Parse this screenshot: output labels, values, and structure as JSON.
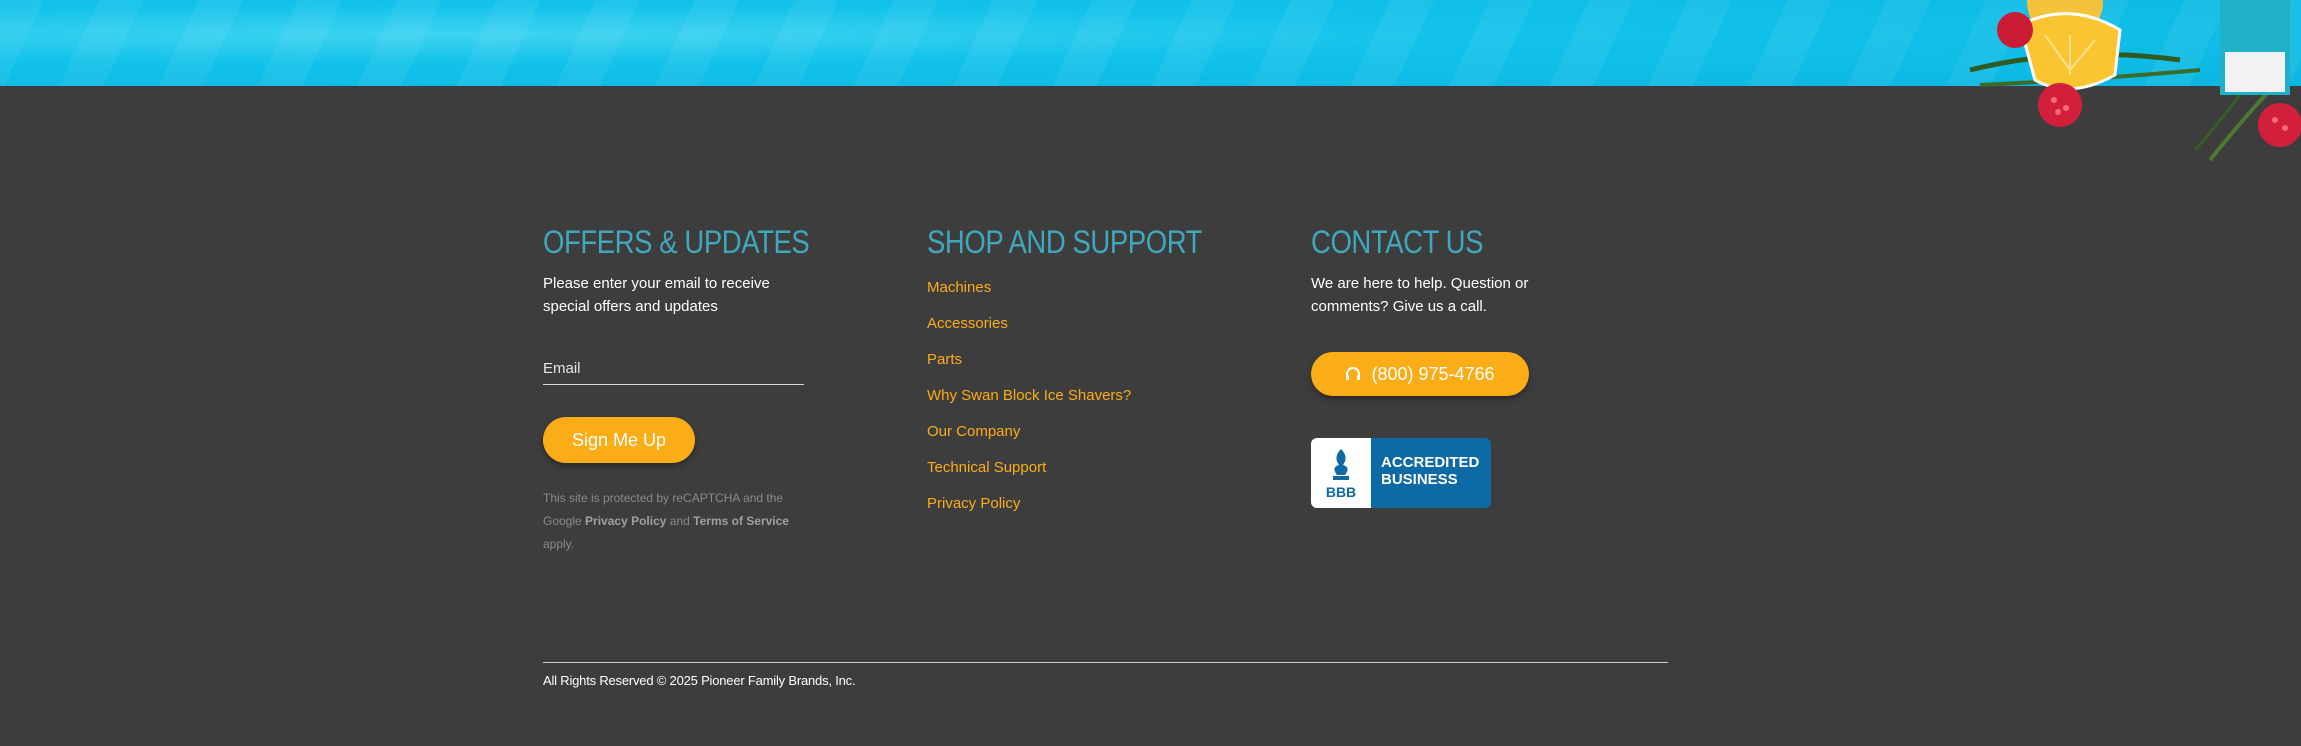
{
  "offers": {
    "title": "OFFERS & UPDATES",
    "description": "Please enter your email to receive special offers and updates",
    "email_placeholder": "Email",
    "signup_label": "Sign Me Up",
    "recaptcha_prefix": "This site is protected by reCAPTCHA and the Google",
    "privacy_link": "Privacy Policy",
    "and_text": "and",
    "terms_link": "Terms of Service",
    "apply_text": "apply."
  },
  "shop": {
    "title": "SHOP AND SUPPORT",
    "links": [
      "Machines",
      "Accessories",
      "Parts",
      "Why Swan Block Ice Shavers?",
      "Our Company",
      "Technical Support",
      "Privacy Policy"
    ]
  },
  "contact": {
    "title": "CONTACT US",
    "description": "We are here to help. Question or comments? Give us a call.",
    "phone": "(800) 975-4766",
    "bbb_mark": "BBB",
    "bbb_line1": "ACCREDITED",
    "bbb_line2": "BUSINESS"
  },
  "footer": {
    "copyright": "All Rights Reserved © 2025 Pioneer Family Brands, Inc."
  },
  "colors": {
    "background": "#3d3d3d",
    "accent": "#fbad18",
    "heading": "#3fa8bd",
    "hero": "#12c2ea",
    "bbb_blue": "#0e6aa5"
  },
  "icons": [
    "headset-icon",
    "bbb-torch-icon"
  ]
}
